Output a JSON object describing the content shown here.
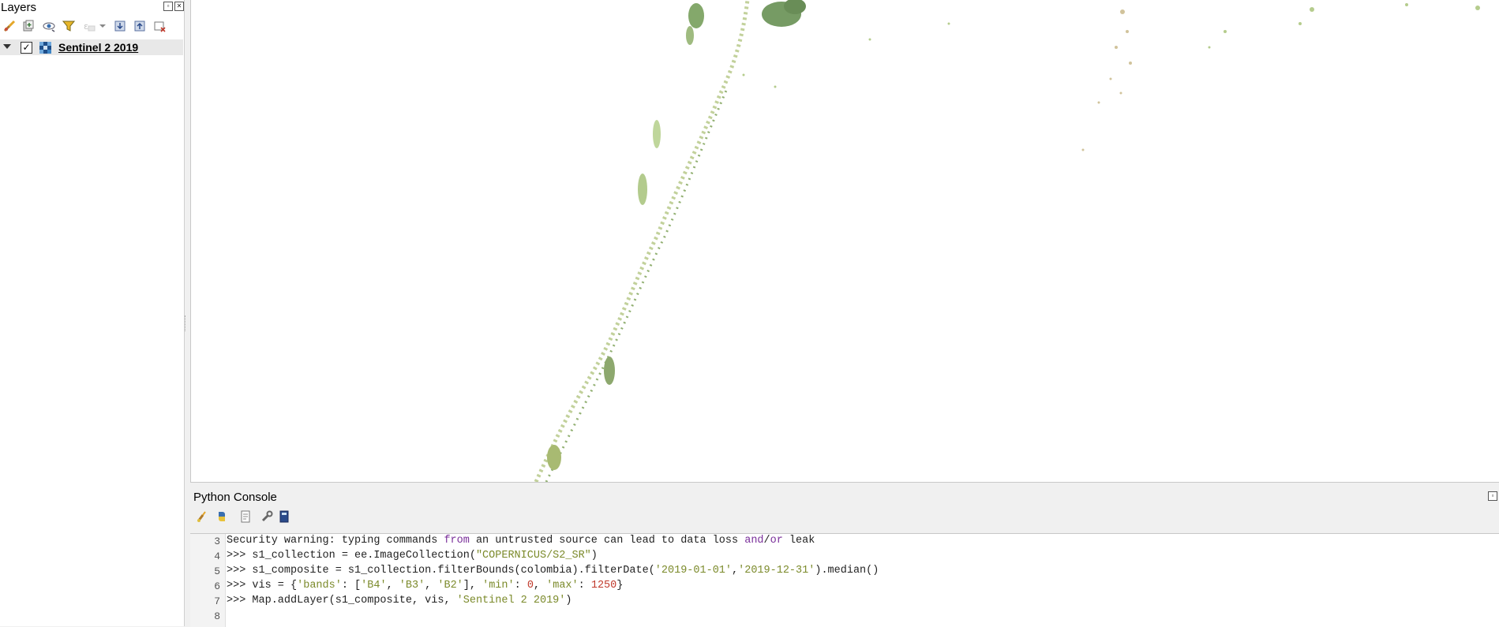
{
  "layers_panel": {
    "title": "Layers",
    "toolbar_icons": [
      "style-manager-icon",
      "add-group-icon",
      "manage-visibility-icon",
      "filter-legend-icon",
      "filter-expression-icon",
      "expand-all-icon",
      "collapse-all-icon",
      "remove-layer-icon"
    ],
    "layers": [
      {
        "name": "Sentinel 2 2019",
        "checked": true,
        "expanded": true
      }
    ]
  },
  "console": {
    "title": "Python Console",
    "toolbar_icons": [
      "clear-console-icon",
      "run-command-icon",
      "show-editor-icon",
      "options-icon",
      "help-icon"
    ],
    "line_numbers": [
      "3",
      "4",
      "5",
      "6",
      "7",
      "8"
    ],
    "lines": {
      "l3": {
        "a": "Security warning: typing commands ",
        "kw1": "from",
        "b": " an untrusted source can lead to data loss ",
        "kw2": "and",
        "c": "/",
        "kw3": "or",
        "d": " leak"
      },
      "l4": {
        "a": ">>> s1_collection = ee.ImageCollection(",
        "s1": "\"COPERNICUS/S2_SR\"",
        "b": ")"
      },
      "l5": {
        "a": ">>> s1_composite = s1_collection.filterBounds(colombia).filterDate(",
        "s1": "'2019-01-01'",
        "b": ",",
        "s2": "'2019-12-31'",
        "c": ").median()"
      },
      "l6": {
        "a": ">>> vis = {",
        "s1": "'bands'",
        "b": ": [",
        "s2": "'B4'",
        "c": ", ",
        "s3": "'B3'",
        "d": ", ",
        "s4": "'B2'",
        "e": "], ",
        "s5": "'min'",
        "f": ": ",
        "n1": "0",
        "g": ", ",
        "s6": "'max'",
        "h": ": ",
        "n2": "1250",
        "i": "}"
      },
      "l7": {
        "a": ">>> Map.addLayer(s1_composite, vis, ",
        "s1": "'Sentinel 2 2019'",
        "b": ")"
      },
      "l8": {
        "a": ""
      }
    }
  },
  "colors": {
    "map_background": "#ffffff",
    "vegetation_dark": "#4f7a3a",
    "vegetation_light": "#a9c47a",
    "keyword": "#7a2f9a",
    "string": "#7b8a2a",
    "number": "#c0392b"
  }
}
